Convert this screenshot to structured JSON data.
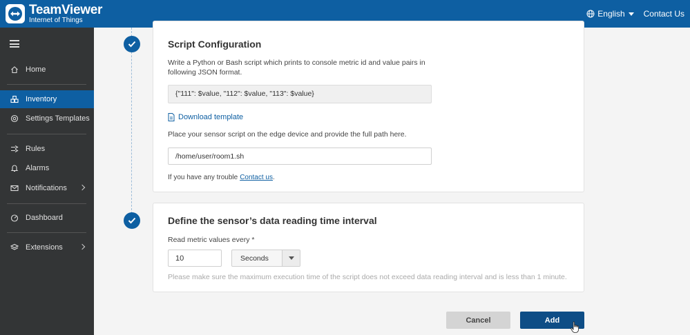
{
  "header": {
    "brand": "TeamViewer",
    "sub_brand": "Internet of Things",
    "language": "English",
    "contact": "Contact Us"
  },
  "sidebar": {
    "items": [
      {
        "label": "Home",
        "icon": "home-icon"
      },
      {
        "label": "Inventory",
        "icon": "inventory-icon",
        "active": true
      },
      {
        "label": "Settings Templates",
        "icon": "settings-templates-icon"
      },
      {
        "label": "Rules",
        "icon": "rules-icon"
      },
      {
        "label": "Alarms",
        "icon": "bell-icon"
      },
      {
        "label": "Notifications",
        "icon": "envelope-icon",
        "has_submenu": true
      },
      {
        "label": "Dashboard",
        "icon": "dashboard-icon"
      },
      {
        "label": "Extensions",
        "icon": "extensions-icon",
        "has_submenu": true
      }
    ]
  },
  "script_config": {
    "title": "Script Configuration",
    "description_line1": "Write a Python or Bash script which prints to console metric id and value pairs in",
    "description_line2": "following JSON format.",
    "json_format": "{\"111\": $value, \"112\": $value, \"113\": $value}",
    "download_label": "Download template",
    "path_instruction": "Place your sensor script on the edge device and provide the full path here.",
    "path_value": "/home/user/room1.sh",
    "trouble_text": "If you have any trouble",
    "trouble_link": "Contact us",
    "trouble_end": "."
  },
  "interval": {
    "title": "Define the sensor’s data reading time interval",
    "label": "Read metric values every *",
    "value": "10",
    "unit": "Seconds",
    "hint": "Please make sure the maximum execution time of the script does not exceed data reading interval and is less than 1 minute."
  },
  "actions": {
    "cancel": "Cancel",
    "add": "Add"
  },
  "colors": {
    "primary": "#0e5fa2",
    "sidebar": "#333536",
    "add_button": "#0e4d86"
  }
}
